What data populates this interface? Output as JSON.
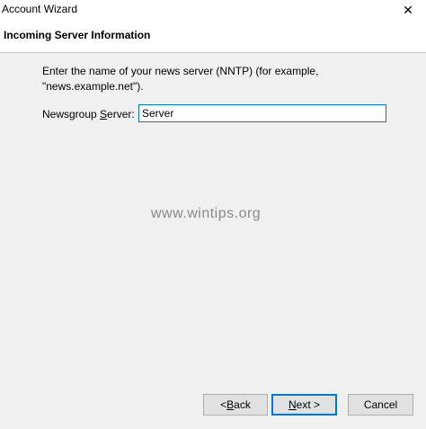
{
  "window": {
    "title": "Account Wizard",
    "close_glyph": "✕"
  },
  "header": {
    "title": "Incoming Server Information"
  },
  "content": {
    "description": "Enter the name of your news server (NNTP) (for example, \"news.example.net\").",
    "field_label_pre": "Newsgroup ",
    "field_label_accel": "S",
    "field_label_post": "erver:",
    "field_value": "Server"
  },
  "watermark": "www.wintips.org",
  "buttons": {
    "back_prefix": "< ",
    "back_accel": "B",
    "back_rest": "ack",
    "next_accel": "N",
    "next_rest": "ext >",
    "cancel": "Cancel"
  },
  "colors": {
    "focus_blue": "#0078d7",
    "dialog_bg": "#f0f0f0"
  }
}
